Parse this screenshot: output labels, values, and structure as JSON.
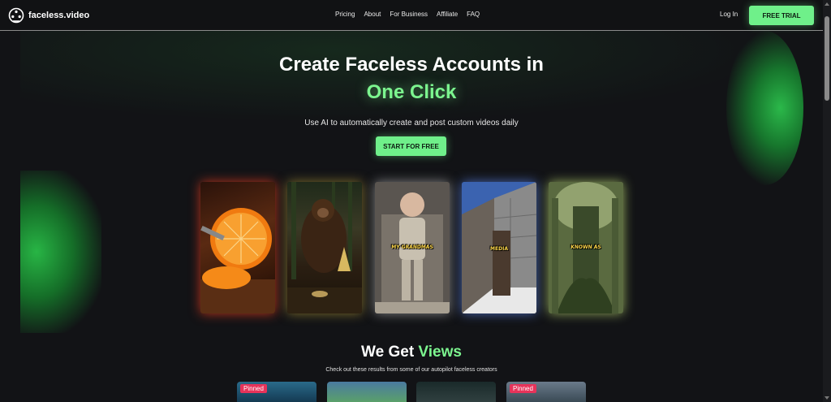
{
  "brand": {
    "name": "faceless.video",
    "logo_icon": "film-reel-icon"
  },
  "nav": {
    "links": [
      "Pricing",
      "About",
      "For Business",
      "Affiliate",
      "FAQ"
    ],
    "login": "Log In",
    "cta": "FREE TRIAL"
  },
  "hero": {
    "title": "Create Faceless Accounts in",
    "accent": "One Click",
    "subtitle": "Use AI to automatically create and post custom videos daily",
    "cta": "START FOR FREE"
  },
  "cards": [
    {
      "caption": "",
      "glow": "#e63c1e"
    },
    {
      "caption": "",
      "glow": "#c8aa3c"
    },
    {
      "caption": "MY GRANDMAS",
      "glow": "#dcdcdc"
    },
    {
      "caption": "MEDIA",
      "glow": "#5a82e6"
    },
    {
      "caption": "KNOWN AS",
      "glow": "#c8e678"
    }
  ],
  "views": {
    "title_prefix": "We Get",
    "title_accent": "Views",
    "subtitle": "Check out these results from some of our autopilot faceless creators",
    "thumbs": [
      {
        "badge": "Pinned"
      },
      {
        "badge": ""
      },
      {
        "badge": ""
      },
      {
        "badge": "Pinned"
      }
    ]
  },
  "colors": {
    "accent": "#7cf58f",
    "button": "#6ff08a",
    "background": "#121316",
    "pinned": "#e6335a"
  }
}
